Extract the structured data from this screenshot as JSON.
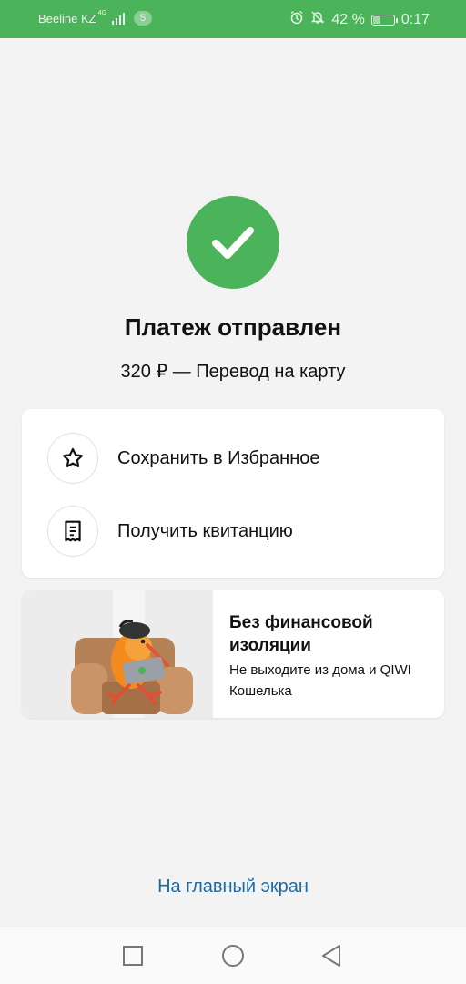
{
  "status_bar": {
    "carrier": "Beeline KZ",
    "network": "4G",
    "sim_badge": "5",
    "battery": "42 %",
    "battery_level": 0.42,
    "time": "0:17",
    "icons": [
      "alarm-icon",
      "bell-off-icon",
      "battery-icon"
    ]
  },
  "result": {
    "icon": "checkmark-icon",
    "title": "Платеж отправлен",
    "subtitle": "320 ₽ — Перевод на карту"
  },
  "actions": [
    {
      "icon": "star-icon",
      "label": "Сохранить в Избранное"
    },
    {
      "icon": "receipt-icon",
      "label": "Получить квитанцию"
    }
  ],
  "promo": {
    "title": "Без финансовой изоляции",
    "text": "Не выходите из дома и QIWI Кошелька"
  },
  "home_link": "На главный экран",
  "nav": [
    "recents-button",
    "home-button",
    "back-button"
  ],
  "colors": {
    "accent_green": "#4bb45a",
    "link_blue": "#1b6aa5",
    "background": "#f3f3f3"
  }
}
